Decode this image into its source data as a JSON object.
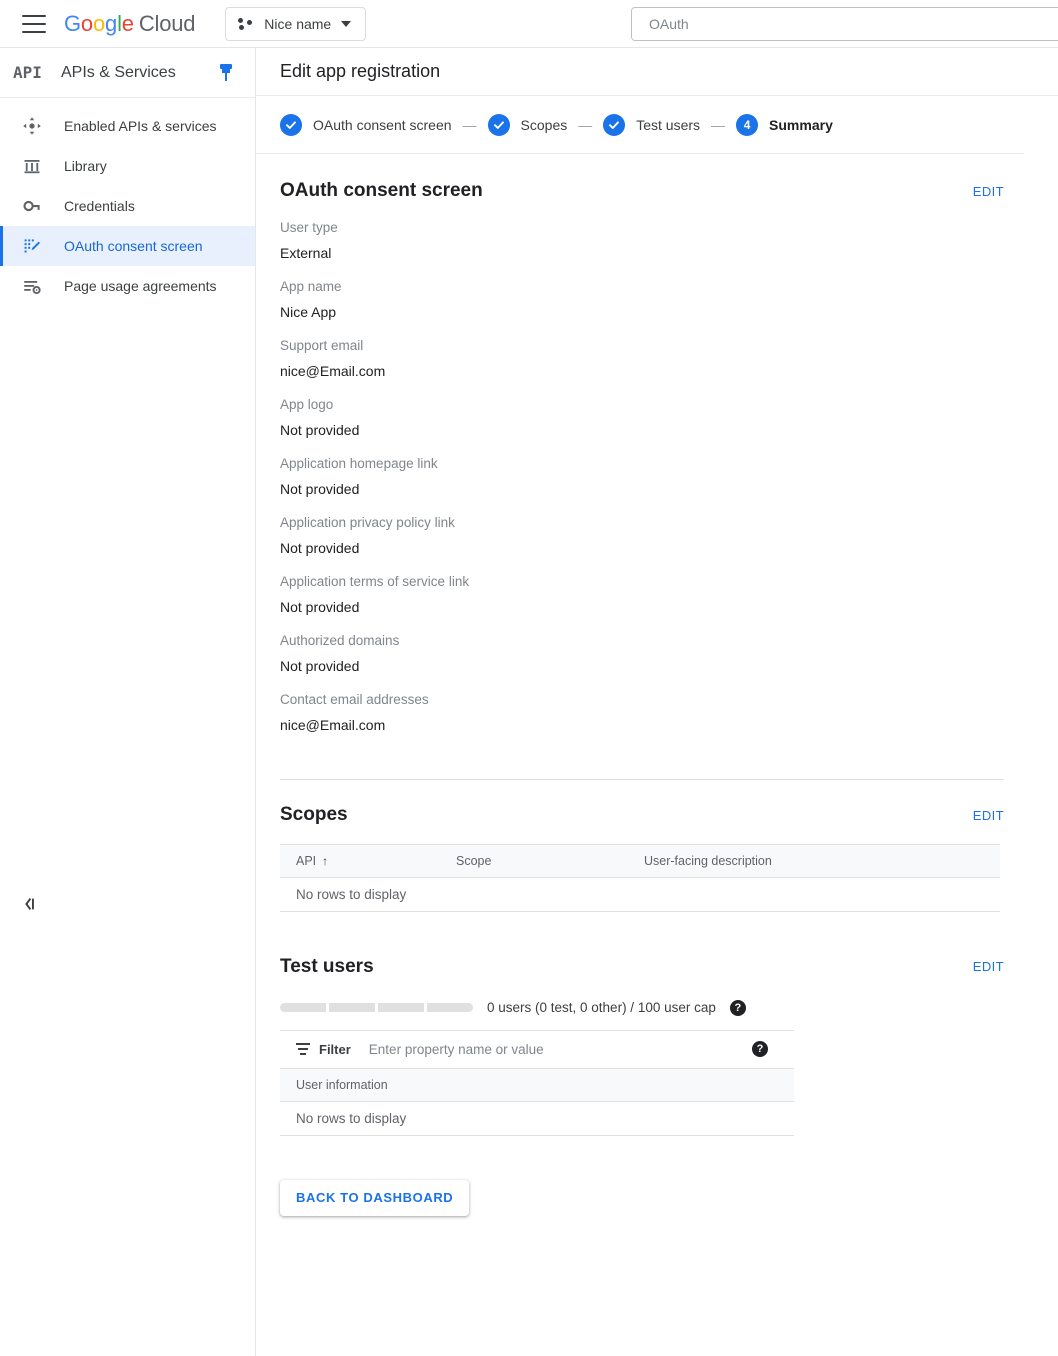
{
  "topbar": {
    "menu_icon": "hamburger-icon",
    "brand_google": "Google",
    "brand_cloud": "Cloud",
    "project_name": "Nice name",
    "search_value": "OAuth"
  },
  "sidebar": {
    "logo_text": "API",
    "title": "APIs & Services",
    "pin_icon": "pin-icon",
    "collapse_icon": "collapse-panel-icon",
    "items": [
      {
        "label": "Enabled APIs & services",
        "icon": "dashboard-icon",
        "active": false
      },
      {
        "label": "Library",
        "icon": "library-icon",
        "active": false
      },
      {
        "label": "Credentials",
        "icon": "key-icon",
        "active": false
      },
      {
        "label": "OAuth consent screen",
        "icon": "consent-screen-icon",
        "active": true
      },
      {
        "label": "Page usage agreements",
        "icon": "page-usage-icon",
        "active": false
      }
    ]
  },
  "page": {
    "title": "Edit app registration"
  },
  "stepper": {
    "separator": "—",
    "steps": [
      {
        "label": "OAuth consent screen",
        "state": "done",
        "num": "1"
      },
      {
        "label": "Scopes",
        "state": "done",
        "num": "2"
      },
      {
        "label": "Test users",
        "state": "done",
        "num": "3"
      },
      {
        "label": "Summary",
        "state": "current",
        "num": "4"
      }
    ]
  },
  "oauth_section": {
    "title": "OAuth consent screen",
    "edit_label": "EDIT",
    "fields": [
      {
        "label": "User type",
        "value": "External"
      },
      {
        "label": "App name",
        "value": "Nice App"
      },
      {
        "label": "Support email",
        "value": "nice@Email.com"
      },
      {
        "label": "App logo",
        "value": "Not provided"
      },
      {
        "label": "Application homepage link",
        "value": "Not provided"
      },
      {
        "label": "Application privacy policy link",
        "value": "Not provided"
      },
      {
        "label": "Application terms of service link",
        "value": "Not provided"
      },
      {
        "label": "Authorized domains",
        "value": "Not provided"
      },
      {
        "label": "Contact email addresses",
        "value": "nice@Email.com"
      }
    ]
  },
  "scopes_section": {
    "title": "Scopes",
    "edit_label": "EDIT",
    "columns": [
      "API",
      "Scope",
      "User-facing description"
    ],
    "sort_column": "API",
    "sort_arrow": "↑",
    "empty_text": "No rows to display"
  },
  "test_users_section": {
    "title": "Test users",
    "edit_label": "EDIT",
    "usage_text": "0 users (0 test, 0 other) / 100 user cap",
    "usage_help_icon": "help-icon",
    "usage_segments": 4,
    "filter_label": "Filter",
    "filter_placeholder": "Enter property name or value",
    "filter_help_icon": "help-icon",
    "columns": [
      "User information"
    ],
    "empty_text": "No rows to display"
  },
  "footer": {
    "back_button": "BACK TO DASHBOARD"
  },
  "colors": {
    "accent_blue": "#1a73e8",
    "active_nav_bg": "#e8f0fe",
    "table_header_bg": "#f8f9fa",
    "muted_text": "#80868b"
  }
}
